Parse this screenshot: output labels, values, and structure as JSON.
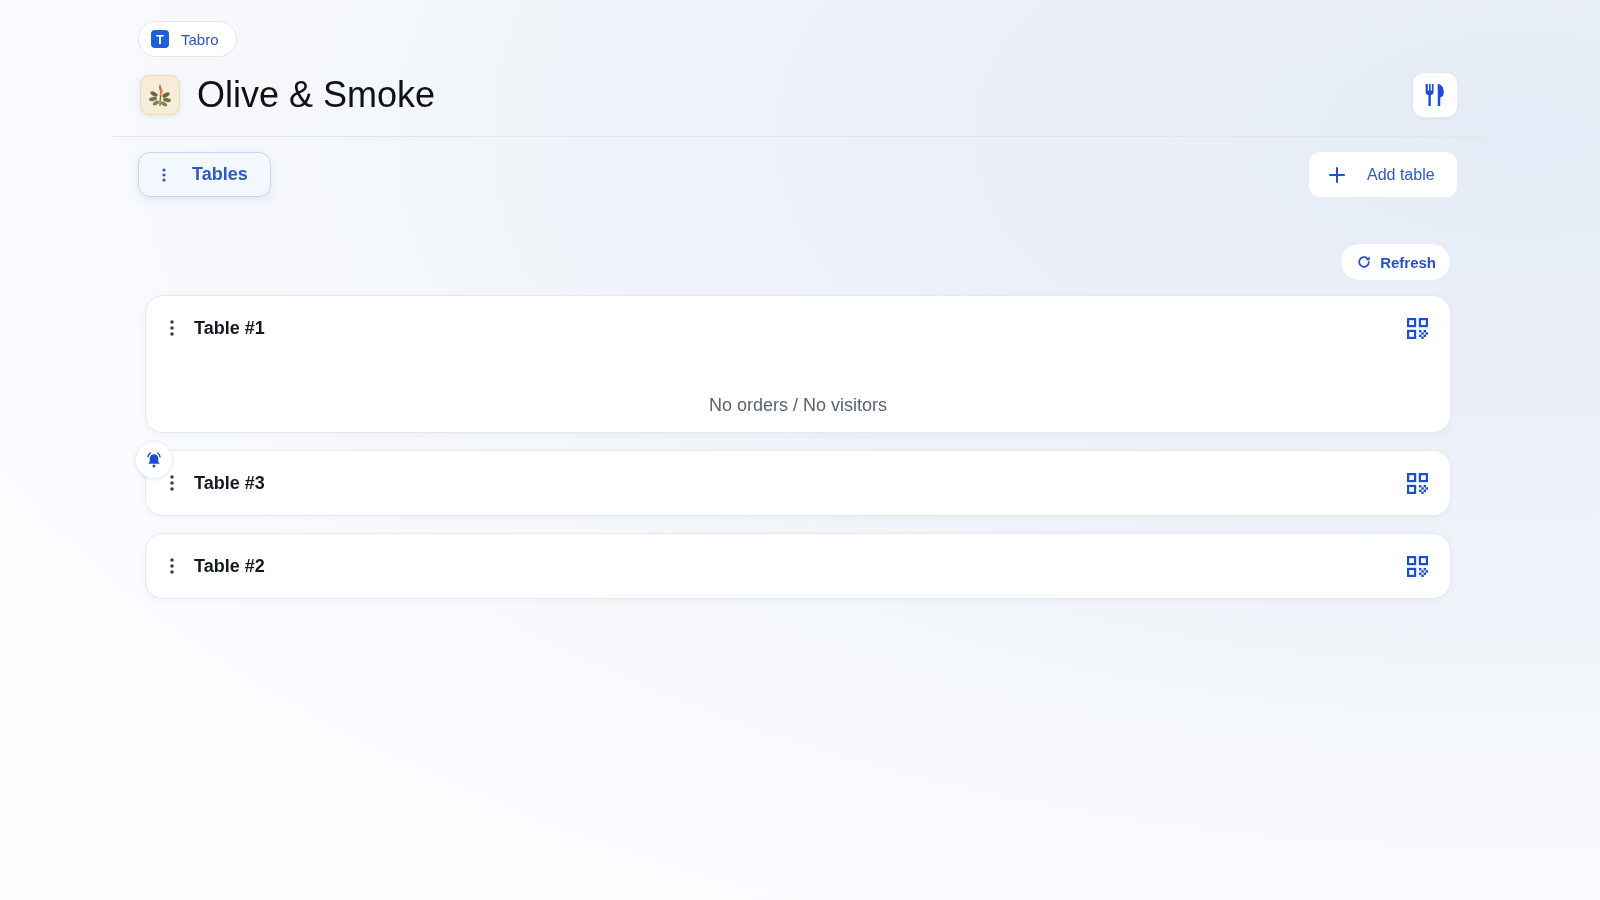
{
  "brand": {
    "logo_letter": "T",
    "name": "Tabro"
  },
  "header": {
    "title": "Olive & Smoke"
  },
  "toolbar": {
    "section_button": "Tables",
    "add_button": "Add table"
  },
  "refresh_button": "Refresh",
  "tables": [
    {
      "name": "Table #1",
      "alert": false,
      "status": "No orders / No visitors"
    },
    {
      "name": "Table #3",
      "alert": true
    },
    {
      "name": "Table #2",
      "alert": false
    }
  ]
}
